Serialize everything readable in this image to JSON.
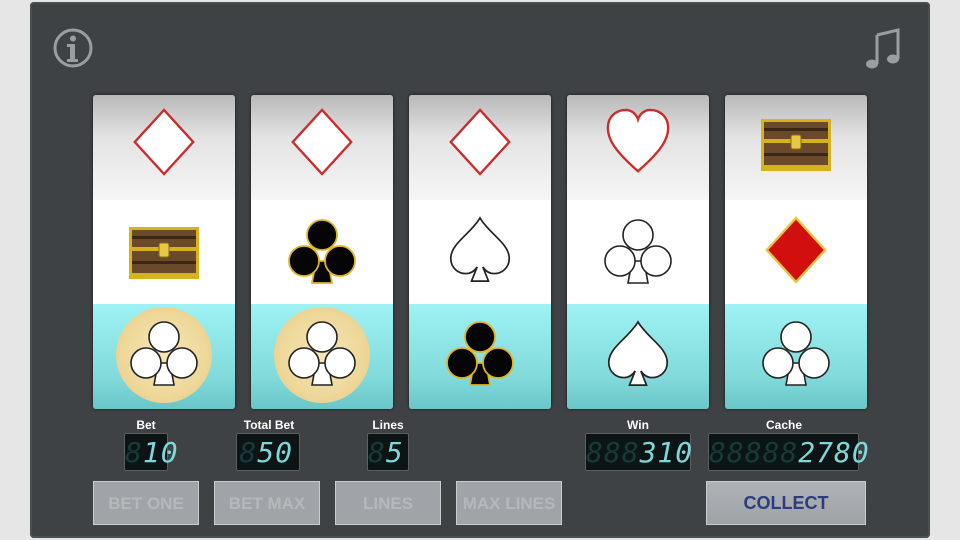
{
  "icons": {
    "info": "info-icon",
    "music": "music-note-icon"
  },
  "reels": [
    [
      "diamond-outline",
      "treasure-chest",
      "club-white"
    ],
    [
      "diamond-outline",
      "club-black",
      "club-white"
    ],
    [
      "diamond-outline",
      "spade-white",
      "club-black"
    ],
    [
      "heart-outline",
      "club-white",
      "spade-white"
    ],
    [
      "treasure-chest",
      "diamond-red",
      "club-white"
    ]
  ],
  "highlighted_reels": [
    1,
    2
  ],
  "meters": {
    "bet": {
      "label": "Bet",
      "value": "10",
      "ghost": "8"
    },
    "total_bet": {
      "label": "Total Bet",
      "value": "50",
      "ghost": "8"
    },
    "lines": {
      "label": "Lines",
      "value": "5",
      "ghost": "8"
    },
    "win": {
      "label": "Win",
      "value": "310",
      "ghost": "888"
    },
    "cache": {
      "label": "Cache",
      "value": "2780",
      "ghost": "88888"
    }
  },
  "buttons": {
    "bet_one": "BET ONE",
    "bet_max": "BET MAX",
    "lines": "LINES",
    "max_lines": "MAX LINES",
    "collect": "COLLECT"
  },
  "colors": {
    "cabinet": "#3e4245",
    "lcd_value": "#7fd8d8",
    "collect_text": "#2c3c7e",
    "win_highlight": "#eed89a"
  }
}
